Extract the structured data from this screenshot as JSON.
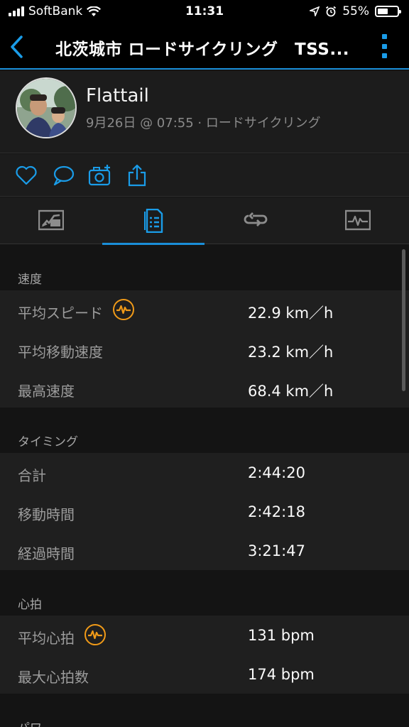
{
  "status_bar": {
    "carrier": "SoftBank",
    "time": "11:31",
    "battery": "55%",
    "battery_fraction": 0.55
  },
  "nav": {
    "title": "北茨城市 ロードサイクリング　TSS..."
  },
  "profile": {
    "name": "Flattail",
    "meta": "9月26日 @ 07:55 · ロードサイクリング"
  },
  "actions": [
    "like-icon",
    "comment-icon",
    "add-photo-icon",
    "share-icon"
  ],
  "tabs": [
    {
      "name": "map-tab",
      "icon": "map-icon",
      "active": false
    },
    {
      "name": "stats-tab",
      "icon": "list-document-icon",
      "active": true
    },
    {
      "name": "laps-tab",
      "icon": "loop-icon",
      "active": false
    },
    {
      "name": "charts-tab",
      "icon": "activity-chart-icon",
      "active": false
    }
  ],
  "sections": [
    {
      "title": "速度",
      "rows": [
        {
          "label": "平均スピード",
          "value": "22.9 km／h",
          "badge": true
        },
        {
          "label": "平均移動速度",
          "value": "23.2 km／h",
          "badge": false
        },
        {
          "label": "最高速度",
          "value": "68.4 km／h",
          "badge": false
        }
      ]
    },
    {
      "title": "タイミング",
      "rows": [
        {
          "label": "合計",
          "value": "2:44:20",
          "badge": false
        },
        {
          "label": "移動時間",
          "value": "2:42:18",
          "badge": false
        },
        {
          "label": "経過時間",
          "value": "3:21:47",
          "badge": false
        }
      ]
    },
    {
      "title": "心拍",
      "rows": [
        {
          "label": "平均心拍",
          "value": "131 bpm",
          "badge": true
        },
        {
          "label": "最大心拍数",
          "value": "174 bpm",
          "badge": false
        }
      ]
    },
    {
      "title": "パワ",
      "rows": []
    }
  ],
  "colors": {
    "accent": "#1a8ed8",
    "badge": "#f09a18",
    "row_bg": "#1f1f1f",
    "bg": "#141414"
  }
}
